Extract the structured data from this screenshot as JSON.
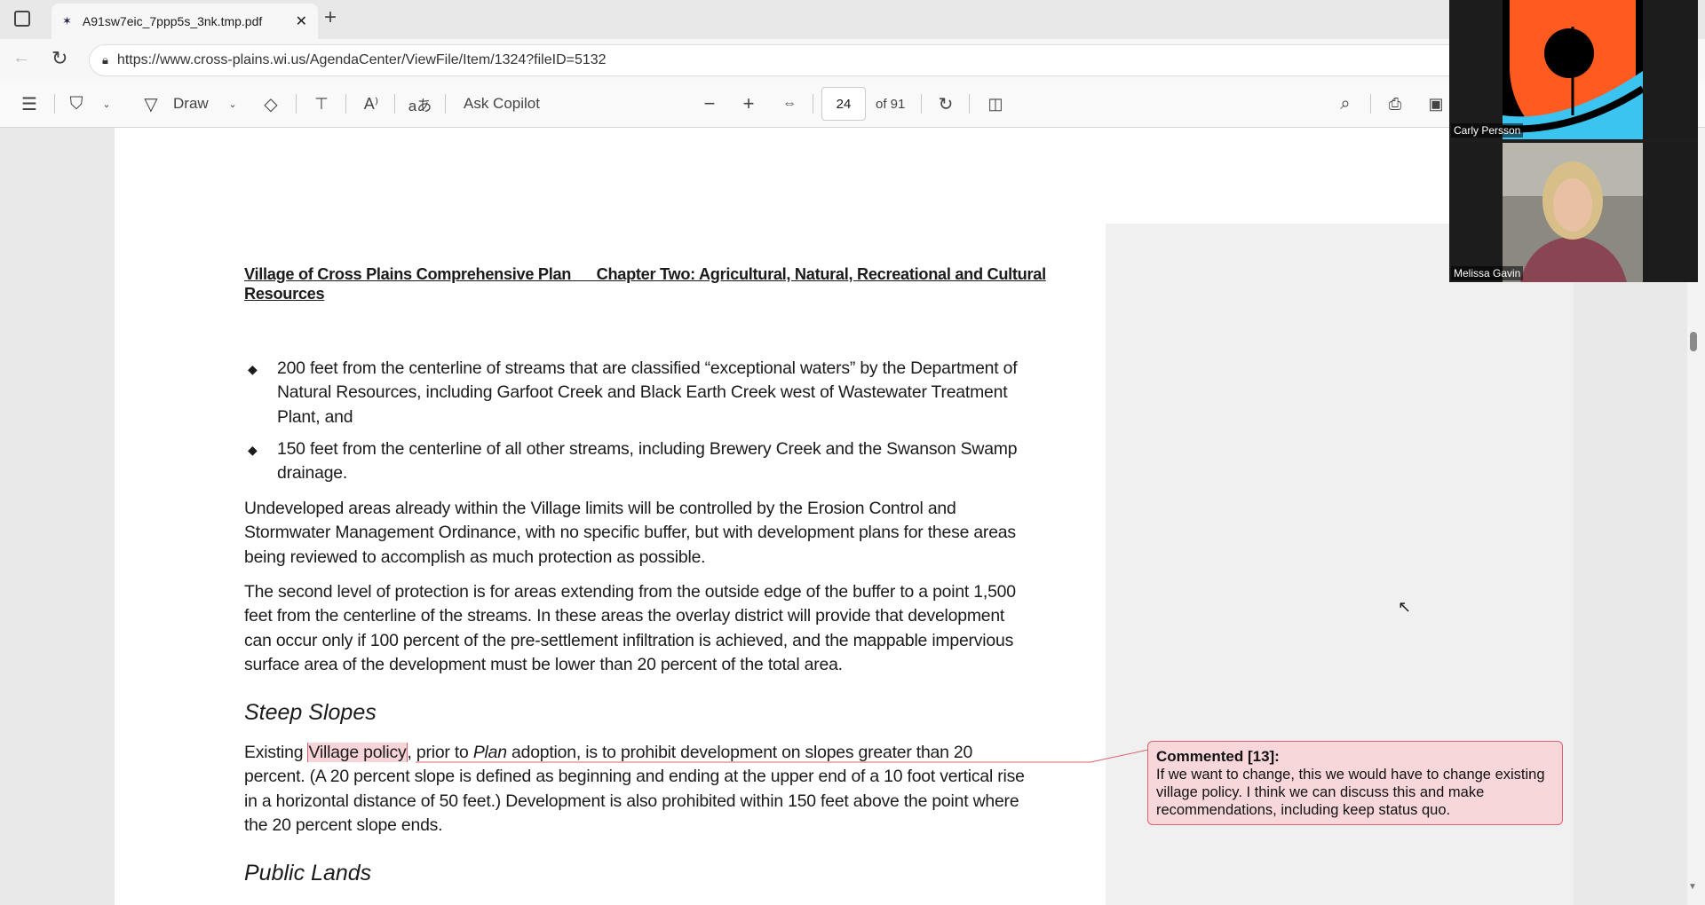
{
  "browser": {
    "tab_title": "A91sw7eic_7ppp5s_3nk.tmp.pdf",
    "url": "https://www.cross-plains.wi.us/AgendaCenter/ViewFile/Item/1324?fileID=5132"
  },
  "toolbar": {
    "draw_label": "Draw",
    "copilot_label": "Ask Copilot",
    "page_current": "24",
    "page_total": "of 91"
  },
  "document": {
    "header": [
      "Village of Cross Plains Comprehensive Plan      Chapter Two: Agricultural, Natural, Recreational and Cultural",
      "Resources"
    ],
    "bullets": [
      [
        "200 feet from the centerline of streams that are classified “exceptional waters” by the Department of",
        "Natural Resources, including Garfoot Creek and Black Earth Creek west of Wastewater Treatment",
        "Plant, and"
      ],
      [
        "150 feet from the centerline of all other streams, including Brewery Creek and the Swanson Swamp",
        "drainage."
      ]
    ],
    "para1": [
      "Undeveloped areas already within the Village limits will be controlled by the Erosion Control and",
      "Stormwater Management Ordinance, with no specific buffer, but with development plans for these areas",
      "being reviewed to accomplish as much protection as possible."
    ],
    "para2": [
      "The second level of protection is for areas extending from the outside edge of the buffer to a point 1,500",
      "feet from the centerline of the streams. In these areas the overlay district will provide that development",
      "can occur only if 100 percent of the pre-settlement infiltration is achieved, and the mappable impervious",
      "surface area of the development must be lower than 20 percent of the total area."
    ],
    "heading_steep": "Steep Slopes",
    "steep_line1": {
      "a": "Existing ",
      "highlight": "Village policy",
      "b": ", prior to ",
      "italic": "Plan",
      "c": " adoption, is to prohibit development on slopes greater than 20"
    },
    "steep_rest": [
      "percent. (A 20 percent slope is defined as beginning and ending at the upper end of a 10 foot vertical rise",
      "in a horizontal distance of 50 feet.) Development is also prohibited within 150 feet above the point where",
      "the 20 percent slope ends."
    ],
    "heading_public": "Public Lands"
  },
  "comment": {
    "title": "Commented [13]:",
    "text": "If we want to change, this we would have to change existing village policy. I think we can discuss this and make recommendations, including keep status quo."
  },
  "video": {
    "participants": [
      {
        "name": "Carly Persson"
      },
      {
        "name": "Melissa Gavin"
      }
    ]
  },
  "colors": {
    "highlight": "#f6d4d8",
    "comment_border": "#d9636e",
    "logo_orange": "#ff5a1f",
    "logo_blue": "#3cc4f0"
  }
}
